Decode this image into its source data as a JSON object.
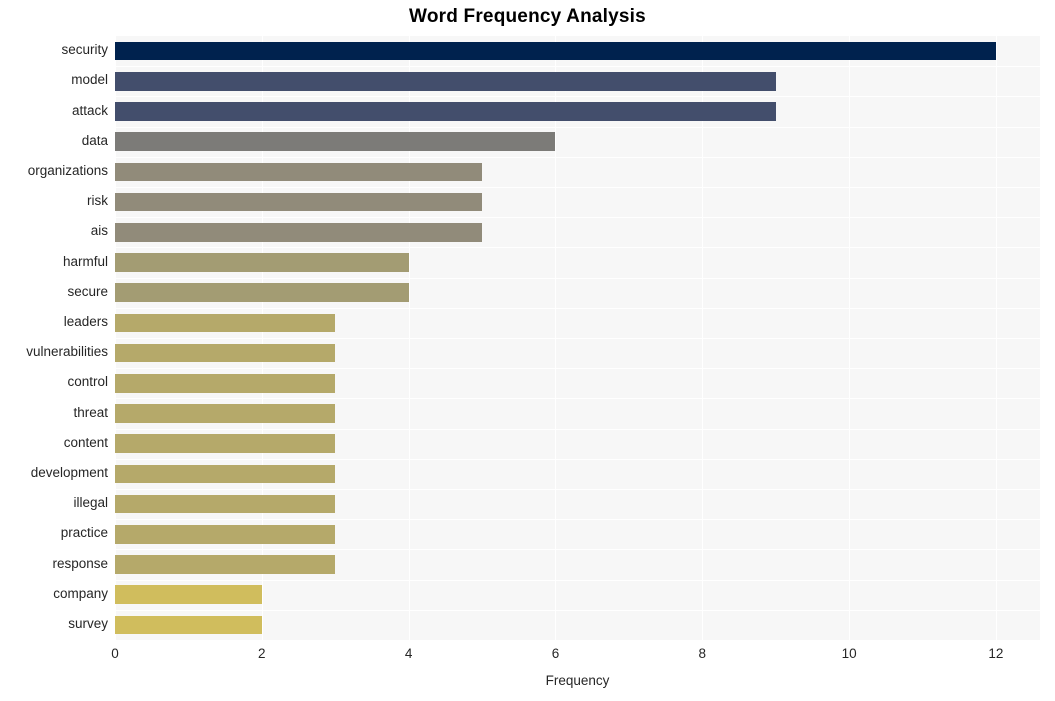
{
  "chart_data": {
    "type": "bar",
    "orientation": "horizontal",
    "title": "Word Frequency Analysis",
    "xlabel": "Frequency",
    "ylabel": "",
    "xlim": [
      0,
      12.6
    ],
    "ylim": [
      0,
      20
    ],
    "grid": true,
    "legend": false,
    "categories": [
      "security",
      "model",
      "attack",
      "data",
      "organizations",
      "risk",
      "ais",
      "harmful",
      "secure",
      "leaders",
      "vulnerabilities",
      "control",
      "threat",
      "content",
      "development",
      "illegal",
      "practice",
      "response",
      "company",
      "survey"
    ],
    "values": [
      12,
      9,
      9,
      6,
      5,
      5,
      5,
      4,
      4,
      3,
      3,
      3,
      3,
      3,
      3,
      3,
      3,
      3,
      2,
      2
    ],
    "bar_colors": [
      "#00224e",
      "#434e6c",
      "#434e6c",
      "#7c7b78",
      "#918b7a",
      "#918b7a",
      "#918b7a",
      "#a39c73",
      "#a39c73",
      "#b5a96a",
      "#b5a96a",
      "#b5a96a",
      "#b5a96a",
      "#b5a96a",
      "#b5a96a",
      "#b5a96a",
      "#b5a96a",
      "#b5a96a",
      "#d0bd5d",
      "#d0bd5d"
    ],
    "x_ticks": [
      0,
      2,
      4,
      6,
      8,
      10,
      12
    ],
    "x_tick_labels": [
      "0",
      "2",
      "4",
      "6",
      "8",
      "10",
      "12"
    ],
    "panel_background": "#f7f7f7",
    "figure_background": "#ffffff",
    "gridline_color": "#ffffff",
    "text_color": "#262626"
  }
}
